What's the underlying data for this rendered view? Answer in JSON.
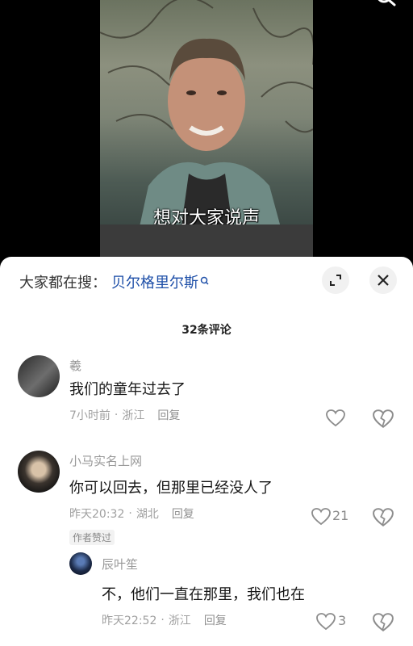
{
  "video": {
    "subtitle": "想对大家说声"
  },
  "sheet": {
    "search_prefix": "大家都在搜：",
    "search_keyword": "贝尔格里尔斯",
    "comment_count_title": "32条评论"
  },
  "comments": [
    {
      "name": "羲",
      "text": "我们的童年过去了",
      "time": "7小时前",
      "location": "浙江",
      "reply_label": "回复",
      "likes": ""
    },
    {
      "name": "小马实名上网",
      "text": "你可以回去，但那里已经没人了",
      "time": "昨天20:32",
      "location": "湖北",
      "reply_label": "回复",
      "likes": "21",
      "badge": "作者赞过"
    }
  ],
  "reply": {
    "name": "辰叶笙",
    "text": "不，他们一直在那里，我们也在",
    "time": "昨天22:52",
    "location": "浙江",
    "reply_label": "回复",
    "likes": "3"
  },
  "colors": {
    "link": "#1e4fa8",
    "meta": "#a0a0a0",
    "sheet_bg": "#ffffff"
  },
  "icons": [
    "search-icon",
    "expand-icon",
    "close-icon",
    "heart-icon",
    "dislike-icon"
  ]
}
